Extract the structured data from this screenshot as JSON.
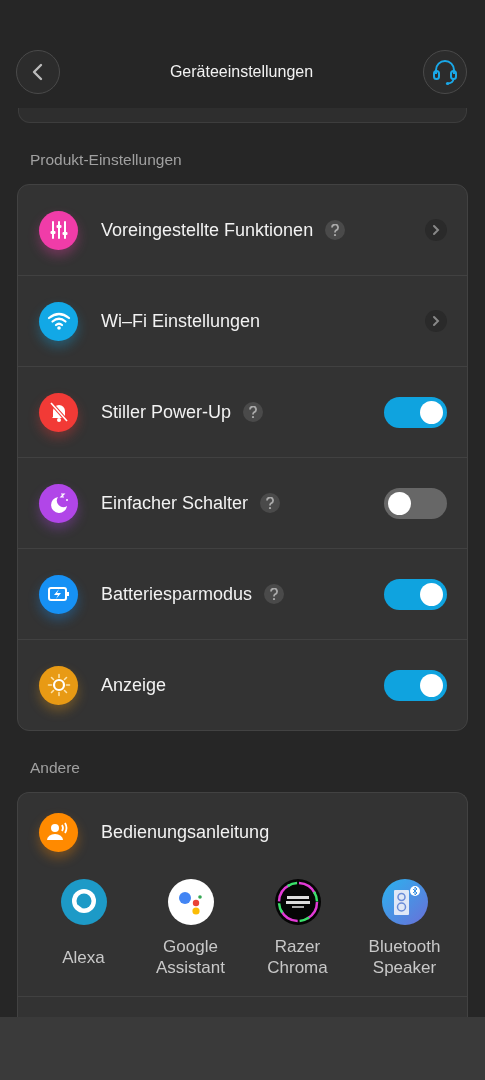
{
  "header": {
    "title": "Geräteeinstellungen"
  },
  "sections": [
    {
      "title": "Produkt-Einstellungen",
      "rows": [
        {
          "label": "Voreingestellte Funktionen",
          "kind": "link",
          "help": true,
          "color": "#f03ca8"
        },
        {
          "label": "Wi–Fi Einstellungen",
          "kind": "link",
          "help": false,
          "color": "#12a8e6"
        },
        {
          "label": "Stiller Power-Up",
          "kind": "toggle",
          "help": true,
          "on": true,
          "color": "#f23a36"
        },
        {
          "label": "Einfacher Schalter",
          "kind": "toggle",
          "help": true,
          "on": false,
          "color": "#b146e8"
        },
        {
          "label": "Batteriesparmodus",
          "kind": "toggle",
          "help": true,
          "on": true,
          "color": "#1691f5"
        },
        {
          "label": "Anzeige",
          "kind": "toggle",
          "help": false,
          "on": true,
          "color": "#e89a14"
        }
      ]
    }
  ],
  "other": {
    "title": "Andere",
    "manual": {
      "label": "Bedienungsanleitung",
      "color": "#ff8a00"
    },
    "apps": [
      {
        "label": "Alexa"
      },
      {
        "label": "Google Assistant"
      },
      {
        "label": "Razer Chroma"
      },
      {
        "label": "Bluetooth Speaker"
      }
    ]
  }
}
